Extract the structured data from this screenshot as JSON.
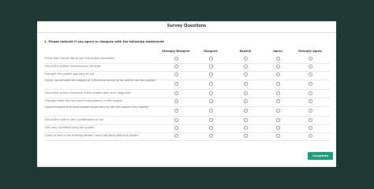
{
  "modal": {
    "title": "Survey Questions",
    "question": "1. Please indicate if you agree or disagree with the following statements",
    "complete_label": "Complete"
  },
  "columns": [
    "Strongly Disagree",
    "Disagree",
    "Neutral",
    "Agree",
    "Strongly Agree"
  ],
  "statements": [
    "I think that I would like to use this system frequently",
    "I found the system unnecessarily complex",
    "I thought the system was easy to use",
    "I think I would need the support of a technical person to be able to use this system",
    "I found the various functions in this system were well integrated",
    "I thought there was too much inconsistency in this system",
    "I would imagine that most people would learn to use this system very quickly",
    "I found the system very cumbersome to use",
    "I felt very confident using the system",
    "I need to learn a lot of things before I could get going with this system"
  ]
}
